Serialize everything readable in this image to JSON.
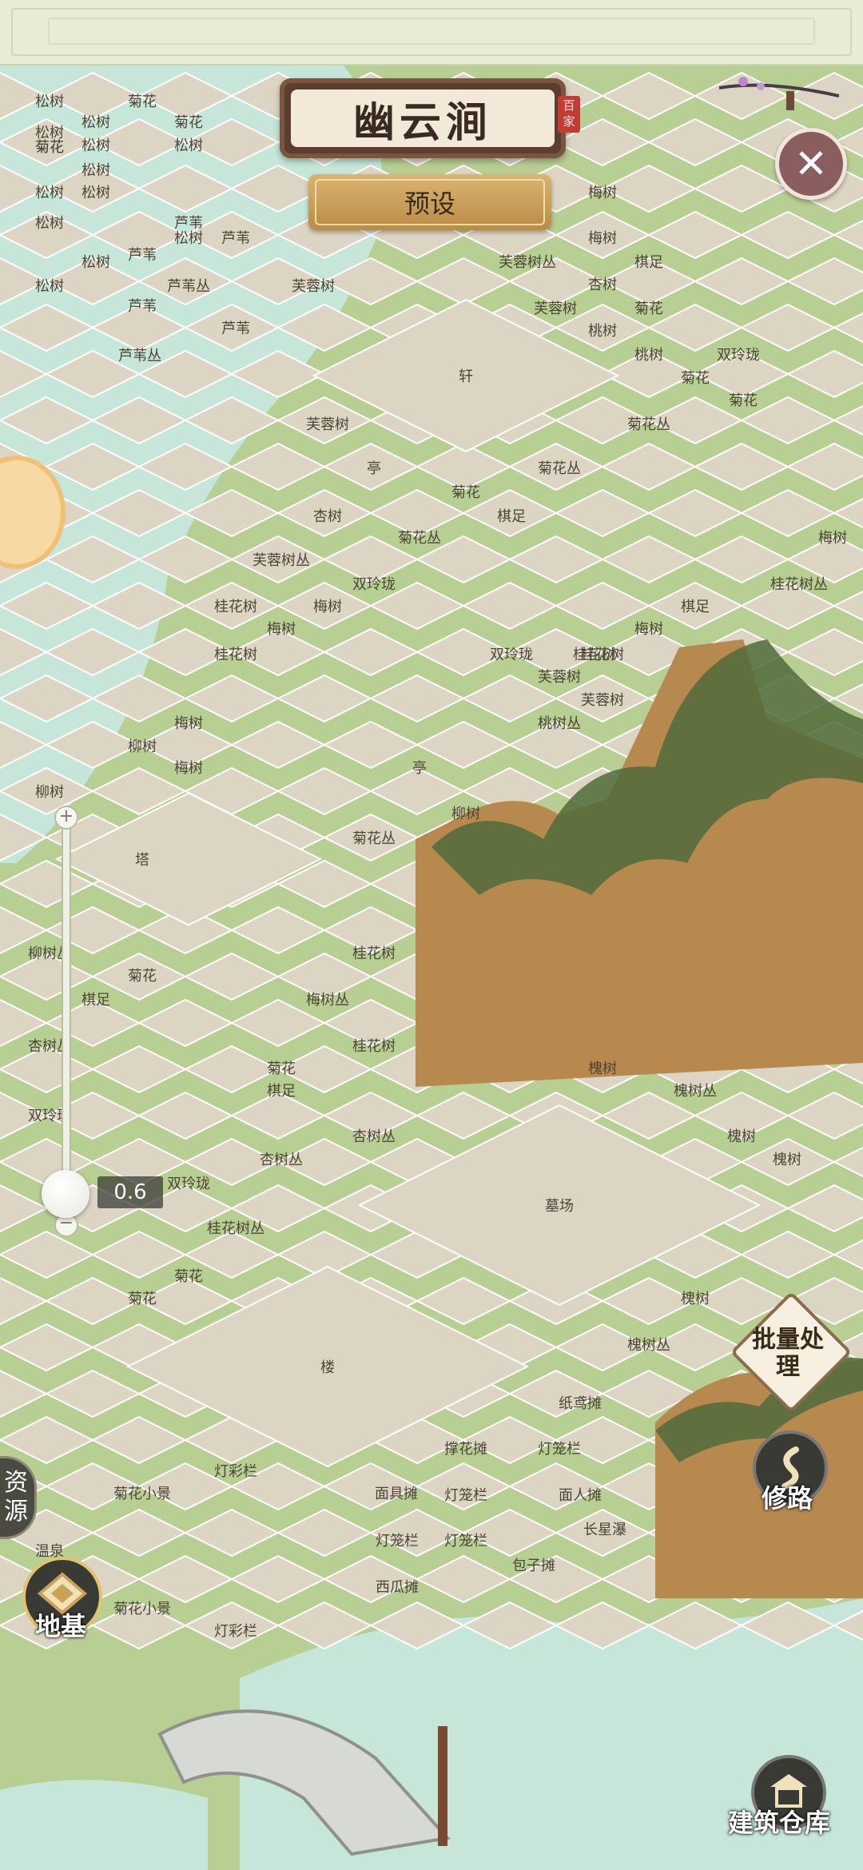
{
  "title": "幽云涧",
  "seal_text": "百家",
  "preset_label": "预设",
  "zoom_value": "0.6",
  "buttons": {
    "resources": "资源",
    "foundation": "地基",
    "batch_process": "批量处理",
    "build_road": "修路",
    "building_warehouse": "建筑仓库"
  },
  "icons": {
    "close": "close-icon",
    "foundation": "foundation-icon",
    "road": "road-icon",
    "warehouse": "pavilion-icon"
  },
  "colors": {
    "plot": "#dcd5c3",
    "grass": "#a9c681",
    "water": "#bfe3d3",
    "cliff": "#b88a55",
    "accent_gold": "#c9a257",
    "plaque_brown": "#5b3e2f"
  },
  "plot_labels": [
    {
      "text": "松树"
    },
    {
      "text": "菊花"
    },
    {
      "text": "松树"
    },
    {
      "text": "菊花"
    },
    {
      "text": "菊花"
    },
    {
      "text": "松树"
    },
    {
      "text": "松树"
    },
    {
      "text": "松树"
    },
    {
      "text": "菊花"
    },
    {
      "text": "松树"
    },
    {
      "text": "松树"
    },
    {
      "text": "松树"
    },
    {
      "text": "松树"
    },
    {
      "text": "芦苇"
    },
    {
      "text": "松树"
    },
    {
      "text": "松树"
    },
    {
      "text": "芦苇"
    },
    {
      "text": "芦苇丛"
    },
    {
      "text": "松树"
    },
    {
      "text": "芦苇"
    },
    {
      "text": "芦苇"
    },
    {
      "text": "芦苇"
    },
    {
      "text": "芦苇丛"
    },
    {
      "text": "芙蓉树"
    },
    {
      "text": "芙蓉树丛"
    },
    {
      "text": "梅树"
    },
    {
      "text": "梅树"
    },
    {
      "text": "棋足"
    },
    {
      "text": "杏树"
    },
    {
      "text": "菊花"
    },
    {
      "text": "芙蓉树"
    },
    {
      "text": "桃树"
    },
    {
      "text": "双玲珑"
    },
    {
      "text": "桃树"
    },
    {
      "text": "菊花"
    },
    {
      "text": "菊花"
    },
    {
      "text": "轩"
    },
    {
      "text": "芙蓉树"
    },
    {
      "text": "菊花丛"
    },
    {
      "text": "亭"
    },
    {
      "text": "菊花丛"
    },
    {
      "text": "菊花"
    },
    {
      "text": "杏树"
    },
    {
      "text": "棋足"
    },
    {
      "text": "菊花丛"
    },
    {
      "text": "梅树"
    },
    {
      "text": "芙蓉树丛"
    },
    {
      "text": "双玲珑"
    },
    {
      "text": "桂花树丛"
    },
    {
      "text": "桂花树"
    },
    {
      "text": "梅树"
    },
    {
      "text": "梅树"
    },
    {
      "text": "棋足"
    },
    {
      "text": "桂花树"
    },
    {
      "text": "梅树"
    },
    {
      "text": "桂花树"
    },
    {
      "text": "双玲珑"
    },
    {
      "text": "桂花树"
    },
    {
      "text": "芙蓉树"
    },
    {
      "text": "芙蓉树"
    },
    {
      "text": "梅树"
    },
    {
      "text": "桃树丛"
    },
    {
      "text": "柳树"
    },
    {
      "text": "柳树"
    },
    {
      "text": "亭"
    },
    {
      "text": "柳树"
    },
    {
      "text": "梅树"
    },
    {
      "text": "塔"
    },
    {
      "text": "菊花丛"
    },
    {
      "text": "柳树丛"
    },
    {
      "text": "桂花树"
    },
    {
      "text": "菊花"
    },
    {
      "text": "梅树丛"
    },
    {
      "text": "棋足"
    },
    {
      "text": "杏树丛"
    },
    {
      "text": "桂花树"
    },
    {
      "text": "菊花"
    },
    {
      "text": "棋足"
    },
    {
      "text": "槐树"
    },
    {
      "text": "槐树丛"
    },
    {
      "text": "杏树丛"
    },
    {
      "text": "双玲珑"
    },
    {
      "text": "杏树丛"
    },
    {
      "text": "槐树"
    },
    {
      "text": "槐树"
    },
    {
      "text": "双玲珑"
    },
    {
      "text": "墓场"
    },
    {
      "text": "桂花树丛"
    },
    {
      "text": "菊花"
    },
    {
      "text": "菊花"
    },
    {
      "text": "槐树"
    },
    {
      "text": "槐树丛"
    },
    {
      "text": "楼"
    },
    {
      "text": "纸鸢摊"
    },
    {
      "text": "灯彩栏"
    },
    {
      "text": "撑花摊"
    },
    {
      "text": "灯笼栏"
    },
    {
      "text": "菊花小景"
    },
    {
      "text": "面具摊"
    },
    {
      "text": "灯笼栏"
    },
    {
      "text": "面人摊"
    },
    {
      "text": "温泉"
    },
    {
      "text": "灯笼栏"
    },
    {
      "text": "灯笼栏"
    },
    {
      "text": "长星瀑"
    },
    {
      "text": "包子摊"
    },
    {
      "text": "菊花小景"
    },
    {
      "text": "西瓜摊"
    },
    {
      "text": "灯彩栏"
    }
  ]
}
